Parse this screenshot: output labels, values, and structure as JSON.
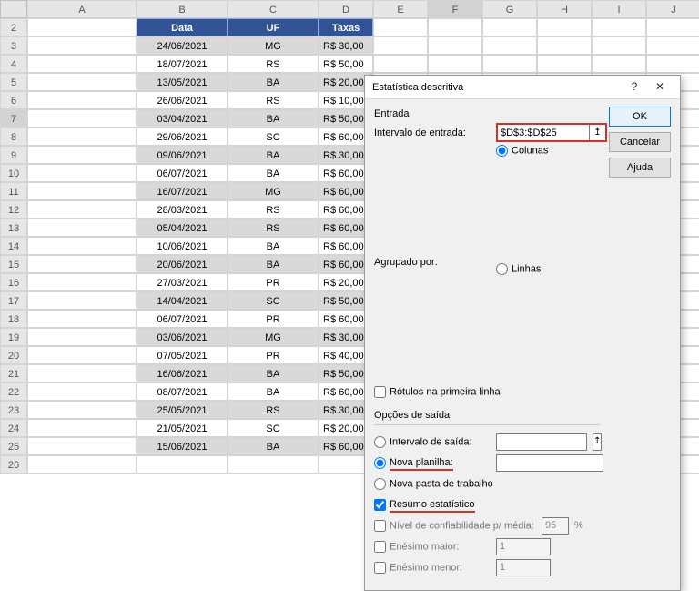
{
  "columns": [
    "A",
    "B",
    "C",
    "D",
    "E",
    "F",
    "G",
    "H",
    "I",
    "J"
  ],
  "headers": {
    "b": "Data",
    "c": "UF",
    "d": "Taxas"
  },
  "rows": [
    {
      "n": 2,
      "hdr": true
    },
    {
      "n": 3,
      "b": "24/06/2021",
      "c": "MG",
      "d": "R$ 30,00",
      "shade": true
    },
    {
      "n": 4,
      "b": "18/07/2021",
      "c": "RS",
      "d": "R$ 50,00"
    },
    {
      "n": 5,
      "b": "13/05/2021",
      "c": "BA",
      "d": "R$ 20,00",
      "shade": true
    },
    {
      "n": 6,
      "b": "26/06/2021",
      "c": "RS",
      "d": "R$ 10,00"
    },
    {
      "n": 7,
      "b": "03/04/2021",
      "c": "BA",
      "d": "R$ 50,00",
      "shade": true,
      "sel": true
    },
    {
      "n": 8,
      "b": "29/06/2021",
      "c": "SC",
      "d": "R$ 60,00"
    },
    {
      "n": 9,
      "b": "09/06/2021",
      "c": "BA",
      "d": "R$ 30,00",
      "shade": true
    },
    {
      "n": 10,
      "b": "06/07/2021",
      "c": "BA",
      "d": "R$ 60,00"
    },
    {
      "n": 11,
      "b": "16/07/2021",
      "c": "MG",
      "d": "R$ 60,00",
      "shade": true
    },
    {
      "n": 12,
      "b": "28/03/2021",
      "c": "RS",
      "d": "R$ 60,00"
    },
    {
      "n": 13,
      "b": "05/04/2021",
      "c": "RS",
      "d": "R$ 60,00",
      "shade": true
    },
    {
      "n": 14,
      "b": "10/06/2021",
      "c": "BA",
      "d": "R$ 60,00"
    },
    {
      "n": 15,
      "b": "20/06/2021",
      "c": "BA",
      "d": "R$ 60,00",
      "shade": true
    },
    {
      "n": 16,
      "b": "27/03/2021",
      "c": "PR",
      "d": "R$ 20,00"
    },
    {
      "n": 17,
      "b": "14/04/2021",
      "c": "SC",
      "d": "R$ 50,00",
      "shade": true
    },
    {
      "n": 18,
      "b": "06/07/2021",
      "c": "PR",
      "d": "R$ 60,00"
    },
    {
      "n": 19,
      "b": "03/06/2021",
      "c": "MG",
      "d": "R$ 30,00",
      "shade": true
    },
    {
      "n": 20,
      "b": "07/05/2021",
      "c": "PR",
      "d": "R$ 40,00"
    },
    {
      "n": 21,
      "b": "16/06/2021",
      "c": "BA",
      "d": "R$ 50,00",
      "shade": true
    },
    {
      "n": 22,
      "b": "08/07/2021",
      "c": "BA",
      "d": "R$ 60,00"
    },
    {
      "n": 23,
      "b": "25/05/2021",
      "c": "RS",
      "d": "R$ 30,00",
      "shade": true
    },
    {
      "n": 24,
      "b": "21/05/2021",
      "c": "SC",
      "d": "R$ 20,00"
    },
    {
      "n": 25,
      "b": "15/06/2021",
      "c": "BA",
      "d": "R$ 60,00",
      "shade": true
    },
    {
      "n": 26
    }
  ],
  "dialog": {
    "title": "Estatística descritiva",
    "help_glyph": "?",
    "close_glyph": "✕",
    "section_input": "Entrada",
    "lbl_input_range": "Intervalo de entrada:",
    "val_input_range": "$D$3:$D$25",
    "lbl_grouped": "Agrupado por:",
    "radio_cols": "Colunas",
    "radio_rows": "Linhas",
    "chk_labels_first": "Rótulos na primeira linha",
    "section_output": "Opções de saída",
    "radio_out_range": "Intervalo de saída:",
    "radio_new_sheet": "Nova planilha:",
    "radio_new_book": "Nova pasta de trabalho",
    "chk_summary": "Resumo estatístico",
    "chk_conf": "Nível de confiabilidade p/ média:",
    "val_conf": "95",
    "pct": "%",
    "chk_kmax": "Enésimo maior:",
    "chk_kmin": "Enésimo menor:",
    "val_k": "1",
    "btn_ok": "OK",
    "btn_cancel": "Cancelar",
    "btn_help": "Ajuda",
    "ref_glyph": "↥"
  }
}
